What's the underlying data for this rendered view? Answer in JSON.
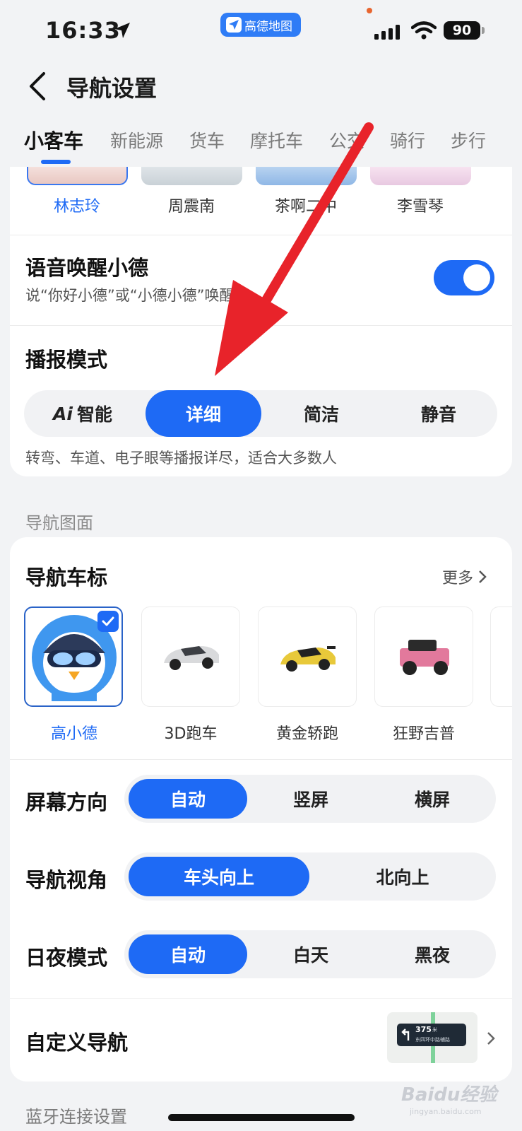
{
  "status_bar": {
    "time": "16:33",
    "app_badge": "高德地图",
    "battery": "90"
  },
  "header": {
    "title": "导航设置"
  },
  "tabs": [
    "小客车",
    "新能源",
    "货车",
    "摩托车",
    "公交",
    "骑行",
    "步行"
  ],
  "voices": [
    "林志玲",
    "周震南",
    "茶啊二中",
    "李雪琴"
  ],
  "wake": {
    "title": "语音唤醒小德",
    "subtitle": "说“你好小德”或“小德小德”唤醒我",
    "enabled": true
  },
  "broadcast": {
    "title": "播报模式",
    "options": [
      "智能",
      "详细",
      "简洁",
      "静音"
    ],
    "ai_prefix": "Ai",
    "selected": "详细",
    "description": "转弯、车道、电子眼等播报详尽，适合大多数人"
  },
  "nav_view_section": "导航图面",
  "car_marker": {
    "title": "导航车标",
    "more": "更多",
    "items": [
      "高小德",
      "3D跑车",
      "黄金轿跑",
      "狂野吉普"
    ],
    "selected": "高小德"
  },
  "screen_orientation": {
    "title": "屏幕方向",
    "options": [
      "自动",
      "竖屏",
      "横屏"
    ],
    "selected": "自动"
  },
  "nav_perspective": {
    "title": "导航视角",
    "options": [
      "车头向上",
      "北向上"
    ],
    "selected": "车头向上"
  },
  "day_night": {
    "title": "日夜模式",
    "options": [
      "自动",
      "白天",
      "黑夜"
    ],
    "selected": "自动"
  },
  "custom_nav": {
    "title": "自定义导航",
    "preview_distance": "375",
    "preview_unit": "米",
    "preview_road": "东四环中路辅路"
  },
  "bluetooth_section": "蓝牙连接设置",
  "watermark": {
    "brand": "Baidu经验",
    "domain": "jingyan.baidu.com"
  },
  "colors": {
    "accent": "#1e6af5",
    "arrow": "#e8232a"
  }
}
